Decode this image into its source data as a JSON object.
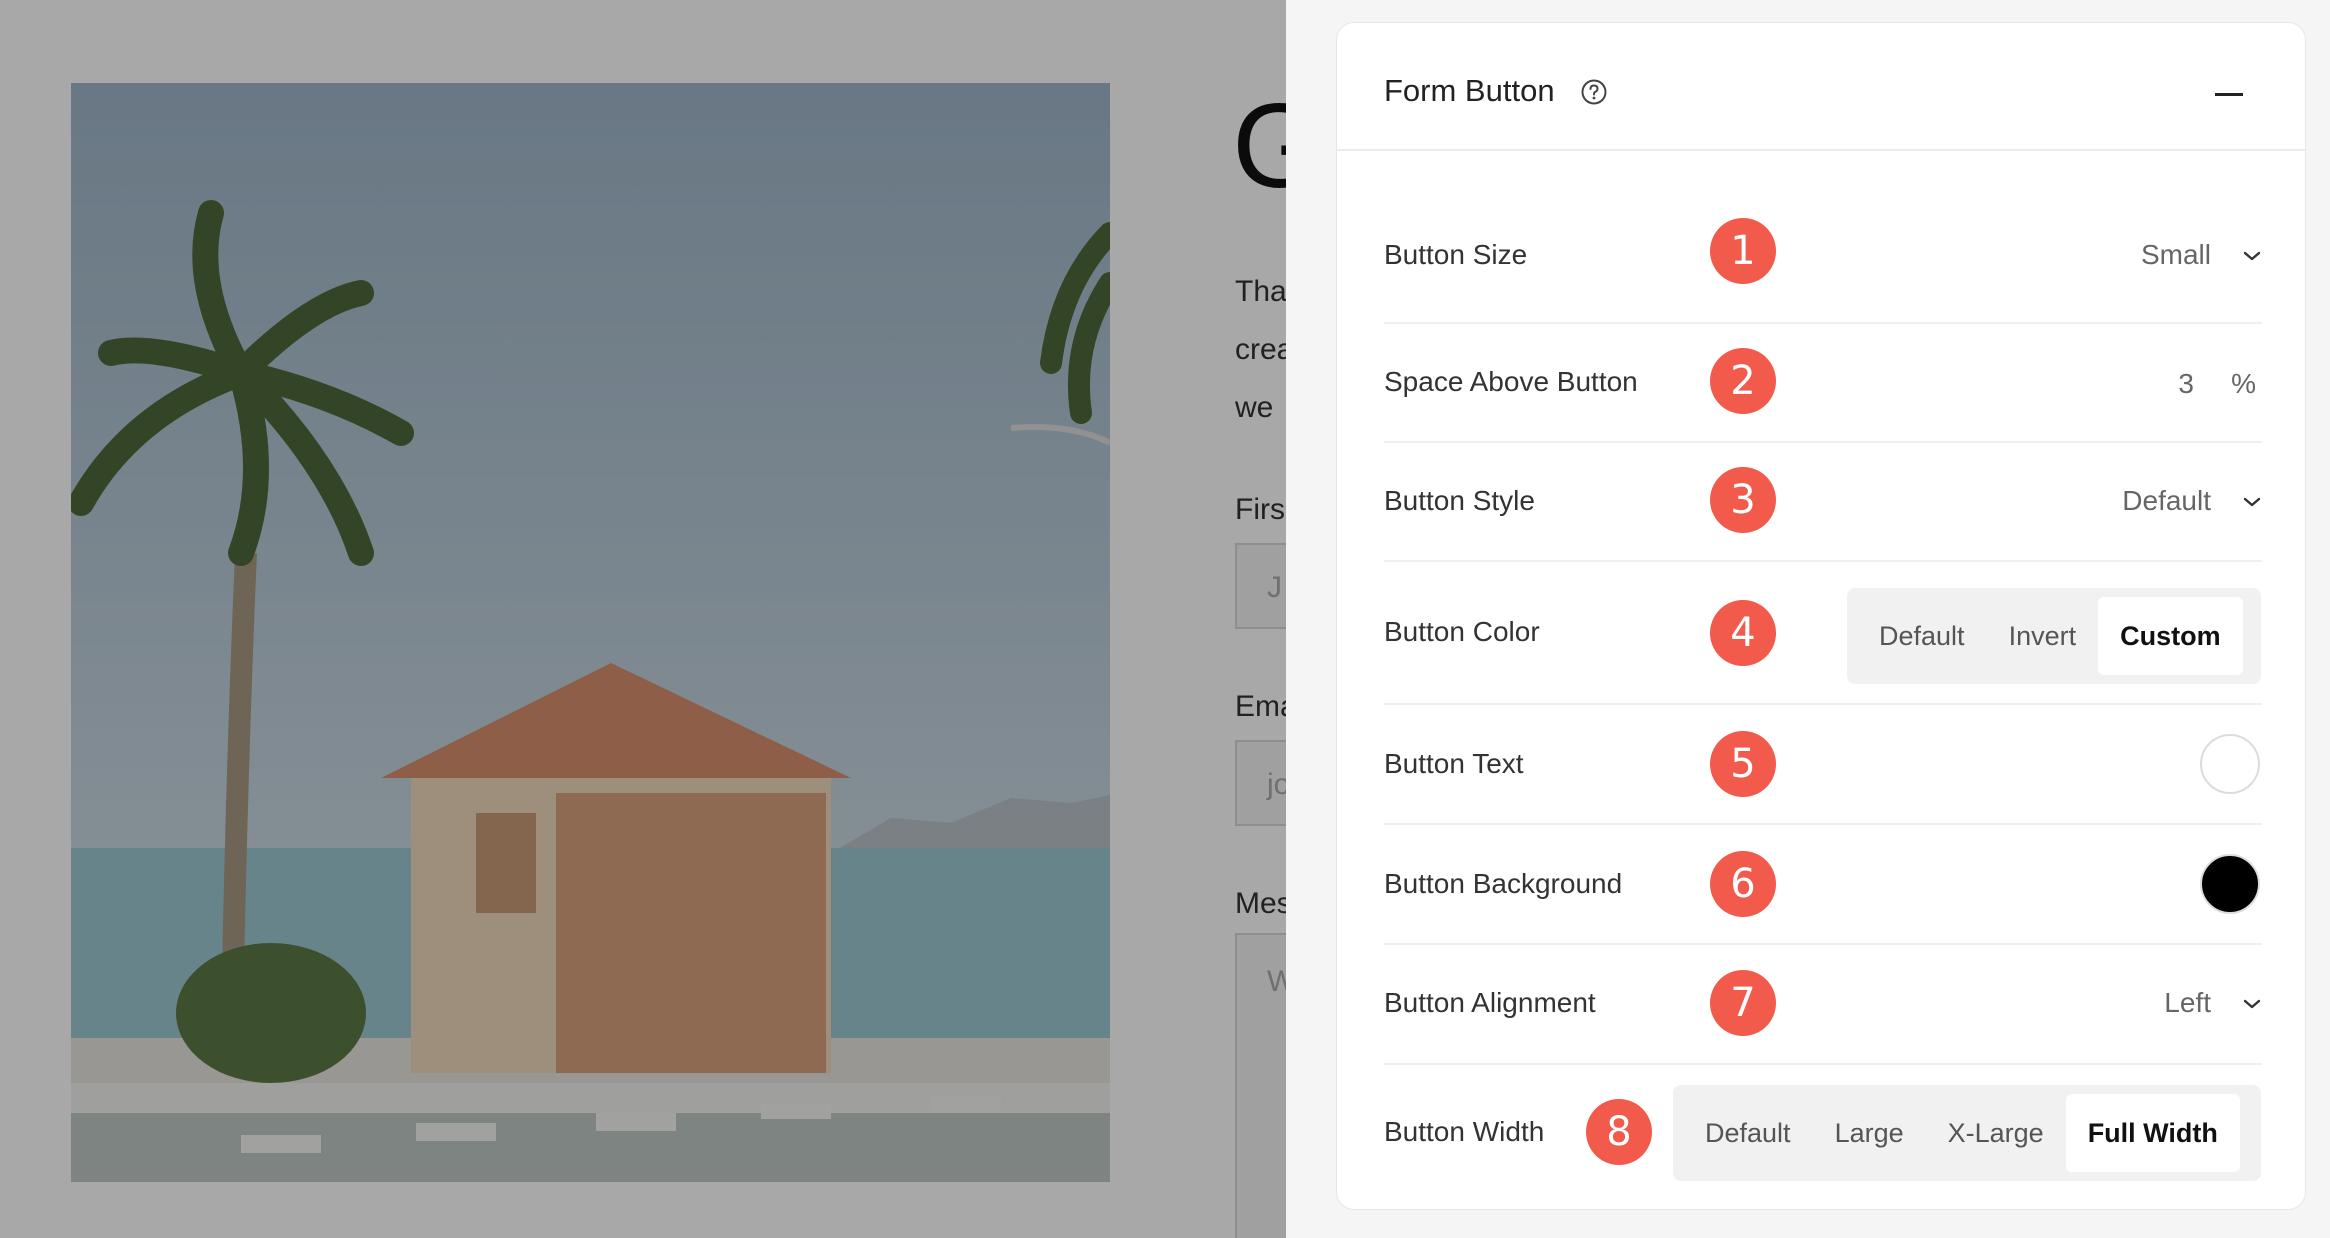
{
  "preview": {
    "heading_fragment": "G",
    "text_lines": [
      "Tha",
      "crea",
      "we"
    ],
    "fields": [
      {
        "label": "Firs",
        "placeholder": "J"
      },
      {
        "label": "Ema",
        "placeholder": "jo"
      },
      {
        "label": "Mes",
        "placeholder": "W"
      }
    ]
  },
  "panel": {
    "title": "Form Button",
    "settings": [
      {
        "label": "Button Size",
        "badge": "1",
        "value": "Small"
      },
      {
        "label": "Space Above Button",
        "badge": "2",
        "value": "3",
        "unit": "%"
      },
      {
        "label": "Button Style",
        "badge": "3",
        "value": "Default"
      },
      {
        "label": "Button Color",
        "badge": "4",
        "options": [
          "Default",
          "Invert",
          "Custom"
        ],
        "selected": "Custom"
      },
      {
        "label": "Button Text",
        "badge": "5",
        "color": "#ffffff"
      },
      {
        "label": "Button Background",
        "badge": "6",
        "color": "#000000"
      },
      {
        "label": "Button Alignment",
        "badge": "7",
        "value": "Left"
      },
      {
        "label": "Button Width",
        "badge": "8",
        "options": [
          "Default",
          "Large",
          "X-Large",
          "Full Width"
        ],
        "selected": "Full Width"
      }
    ]
  },
  "colors": {
    "badge": "#f25a4c",
    "overlay": "rgba(0,0,0,0.34)"
  }
}
